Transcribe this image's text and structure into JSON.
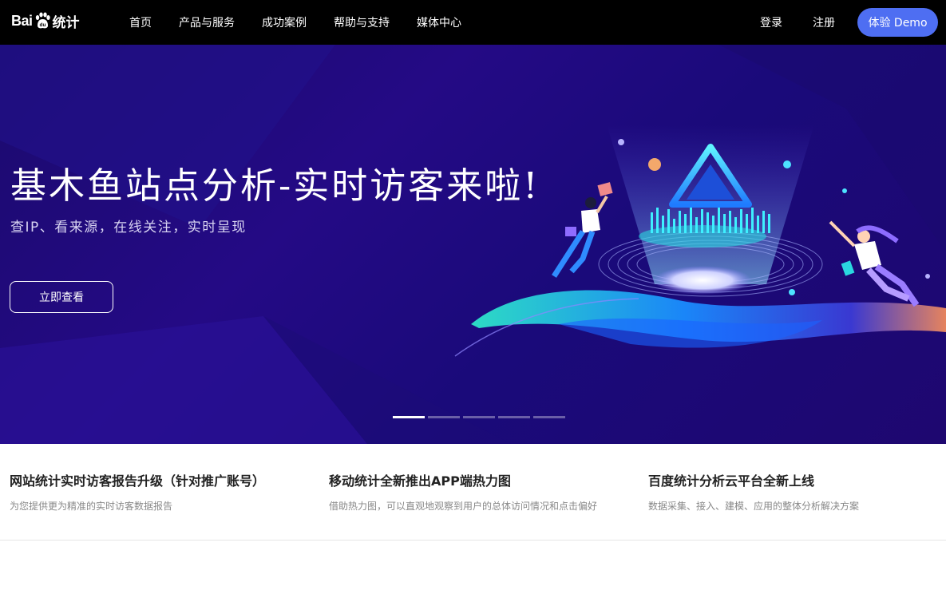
{
  "header": {
    "logo_text": "Bai",
    "logo_cn": "统计",
    "nav": [
      {
        "label": "首页"
      },
      {
        "label": "产品与服务"
      },
      {
        "label": "成功案例"
      },
      {
        "label": "帮助与支持"
      },
      {
        "label": "媒体中心"
      }
    ],
    "login": "登录",
    "register": "注册",
    "demo_button": "体验 Demo",
    "demo_color": "#4e6ef2"
  },
  "banner": {
    "title": "基木鱼站点分析-实时访客来啦!",
    "subtitle": "查IP、看来源，在线关注，实时呈现",
    "button": "立即查看",
    "slides_total": 5,
    "active_slide": 1
  },
  "news": [
    {
      "title": "网站统计实时访客报告升级（针对推广账号）",
      "desc": "为您提供更为精准的实时访客数据报告"
    },
    {
      "title": "移动统计全新推出APP端热力图",
      "desc": "借助热力图，可以直观地观察到用户的总体访问情况和点击偏好"
    },
    {
      "title": "百度统计分析云平台全新上线",
      "desc": "数据采集、接入、建模、应用的整体分析解决方案"
    }
  ]
}
